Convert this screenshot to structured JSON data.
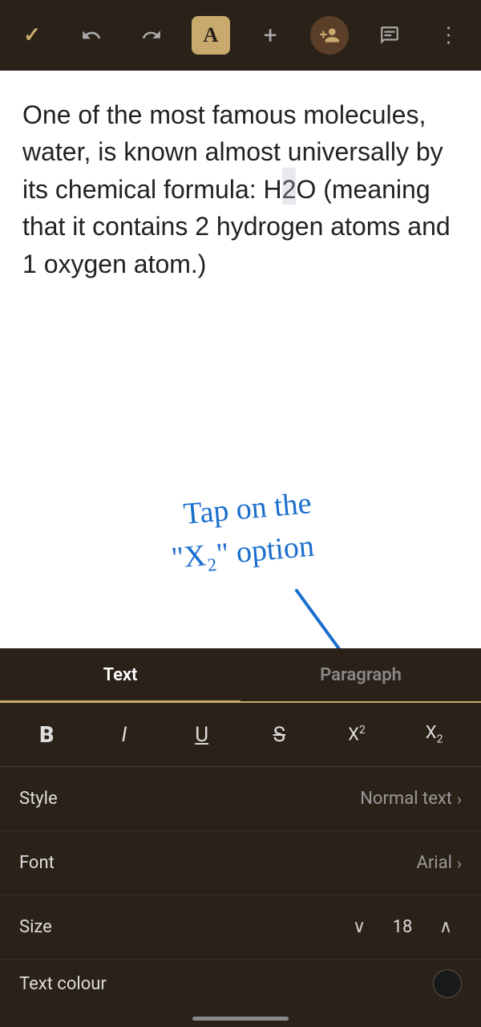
{
  "toolbar": {
    "check_icon": "✓",
    "undo_icon": "↩",
    "redo_icon": "↪",
    "font_icon": "A",
    "add_icon": "+",
    "avatar_icon": "👤",
    "comment_icon": "▤",
    "more_icon": "⋮"
  },
  "document": {
    "content": "One of the most famous molecules, water, is known almost universally by its chemical formula: H2O (meaning that it contains 2 hydrogen atoms and 1 oxygen atom.)"
  },
  "annotation": {
    "line1": "Tap on the",
    "line2": "\"X₂\" option"
  },
  "tabs": {
    "text_label": "Text",
    "paragraph_label": "Paragraph"
  },
  "format_buttons": {
    "bold": "B",
    "italic": "I",
    "underline": "U",
    "strikethrough": "S",
    "superscript": "X²",
    "subscript": "X₂"
  },
  "style_row": {
    "label": "Style",
    "value": "Normal text"
  },
  "font_row": {
    "label": "Font",
    "value": "Arial"
  },
  "size_row": {
    "label": "Size",
    "value": "18",
    "down_icon": "∨",
    "up_icon": "∧"
  },
  "color_row": {
    "label": "Text colour"
  }
}
